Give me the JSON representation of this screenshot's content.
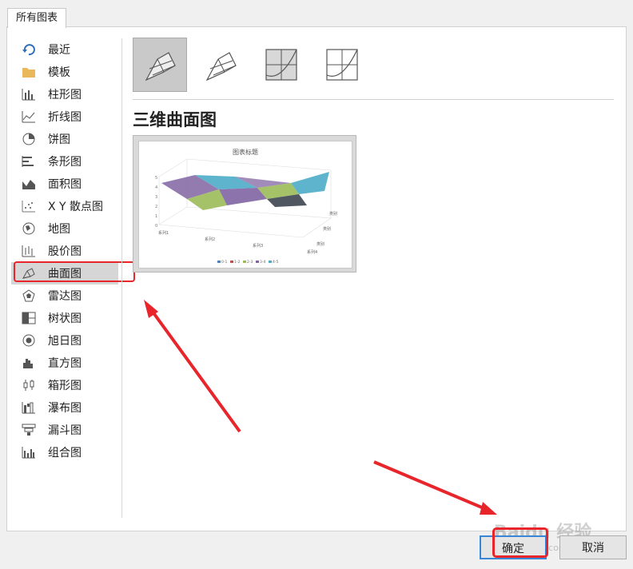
{
  "tab": {
    "label": "所有图表"
  },
  "sidebar": {
    "items": [
      {
        "label": "最近",
        "icon": "recent-icon"
      },
      {
        "label": "模板",
        "icon": "folder-icon"
      },
      {
        "label": "柱形图",
        "icon": "column-chart-icon"
      },
      {
        "label": "折线图",
        "icon": "line-chart-icon"
      },
      {
        "label": "饼图",
        "icon": "pie-chart-icon"
      },
      {
        "label": "条形图",
        "icon": "bar-chart-icon"
      },
      {
        "label": "面积图",
        "icon": "area-chart-icon"
      },
      {
        "label": "X Y 散点图",
        "icon": "scatter-chart-icon"
      },
      {
        "label": "地图",
        "icon": "map-chart-icon"
      },
      {
        "label": "股价图",
        "icon": "stock-chart-icon"
      },
      {
        "label": "曲面图",
        "icon": "surface-chart-icon",
        "selected": true
      },
      {
        "label": "雷达图",
        "icon": "radar-chart-icon"
      },
      {
        "label": "树状图",
        "icon": "treemap-chart-icon"
      },
      {
        "label": "旭日图",
        "icon": "sunburst-chart-icon"
      },
      {
        "label": "直方图",
        "icon": "histogram-chart-icon"
      },
      {
        "label": "箱形图",
        "icon": "box-chart-icon"
      },
      {
        "label": "瀑布图",
        "icon": "waterfall-chart-icon"
      },
      {
        "label": "漏斗图",
        "icon": "funnel-chart-icon"
      },
      {
        "label": "组合图",
        "icon": "combo-chart-icon"
      }
    ]
  },
  "main": {
    "subtypes": [
      "3d-surface-icon",
      "wireframe-3d-surface-icon",
      "contour-icon",
      "wireframe-contour-icon"
    ],
    "selected_title": "三维曲面图",
    "preview": {
      "chart_title": "图表标题",
      "x_labels": [
        "系列1",
        "系列2",
        "系列3",
        "系列4"
      ],
      "side_labels": [
        "类别",
        "类别",
        "类别"
      ],
      "y_ticks": [
        "5",
        "4",
        "3",
        "2",
        "1",
        "0"
      ],
      "legend": [
        "0-1",
        "1-2",
        "2-3",
        "3-4",
        "4-5"
      ],
      "colors": [
        "#4f81bd",
        "#c0504d",
        "#9bbb59",
        "#8064a2",
        "#4bacc6"
      ]
    }
  },
  "buttons": {
    "ok": "确定",
    "cancel": "取消"
  },
  "watermark": {
    "text": "Baidu 经验",
    "url": "jingyan.baidu.com"
  },
  "annotation_colors": {
    "highlight": "#e8252a"
  }
}
